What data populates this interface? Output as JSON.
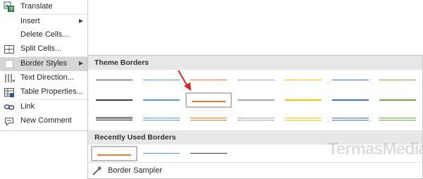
{
  "menu": {
    "items": [
      {
        "label": "Translate",
        "icon": "translate-icon",
        "submenu": false
      },
      {
        "label": "Insert",
        "icon": "",
        "submenu": true
      },
      {
        "label": "Delete Cells...",
        "icon": "",
        "submenu": false
      },
      {
        "label": "Split Cells...",
        "icon": "split-cells-icon",
        "submenu": false
      },
      {
        "label": "Border Styles",
        "icon": "border-styles-icon",
        "submenu": true
      },
      {
        "label": "Text Direction...",
        "icon": "text-direction-icon",
        "submenu": false
      },
      {
        "label": "Table Properties...",
        "icon": "table-properties-icon",
        "submenu": false
      },
      {
        "label": "Link",
        "icon": "link-icon",
        "submenu": false
      },
      {
        "label": "New Comment",
        "icon": "new-comment-icon",
        "submenu": false
      }
    ],
    "highlight_color": "#d6d6d6"
  },
  "border_styles": {
    "theme_heading": "Theme Borders",
    "theme_colors": [
      "#404040",
      "#5b9bd5",
      "#ed7d31",
      "#a5a5a5",
      "#ffc000",
      "#4472c4",
      "#70ad47"
    ],
    "selected_swatch": "row 2, column 3",
    "recent_heading": "Recently Used Borders",
    "recent_colors": [
      "#ed7d31",
      "#5b9bd5",
      "#404040"
    ],
    "sampler_label": "Border Sampler"
  },
  "annotation": {
    "arrow_color": "#e0201b"
  },
  "watermark": "TermasMedia"
}
